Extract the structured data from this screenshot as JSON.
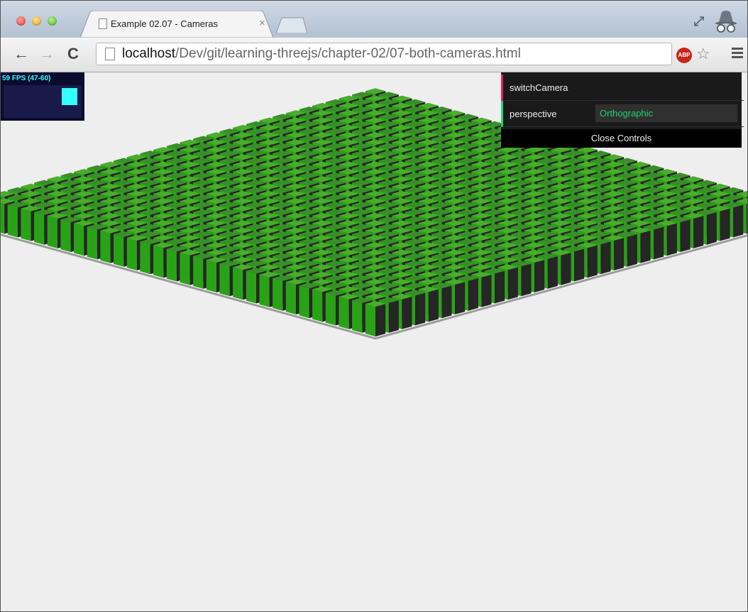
{
  "browser": {
    "tab_title": "Example 02.07 - Cameras",
    "tab_close": "×",
    "url_host": "localhost",
    "url_path": "/Dev/git/learning-threejs/chapter-02/07-both-cameras.html",
    "abp_badge": "ABP"
  },
  "stats": {
    "fps_text": "59 FPS (47-60)"
  },
  "controls": {
    "switch_label": "switchCamera",
    "perspective_label": "perspective",
    "perspective_value": "Orthographic",
    "close_label": "Close Controls"
  },
  "scene": {
    "grid_columns": 30,
    "grid_rows": 30,
    "top_color": "#3a8e2a",
    "top_highlight": "#4aad2c",
    "front_color": "#29a316",
    "side_color": "#262626",
    "plane_color": "#9a9a9a"
  }
}
